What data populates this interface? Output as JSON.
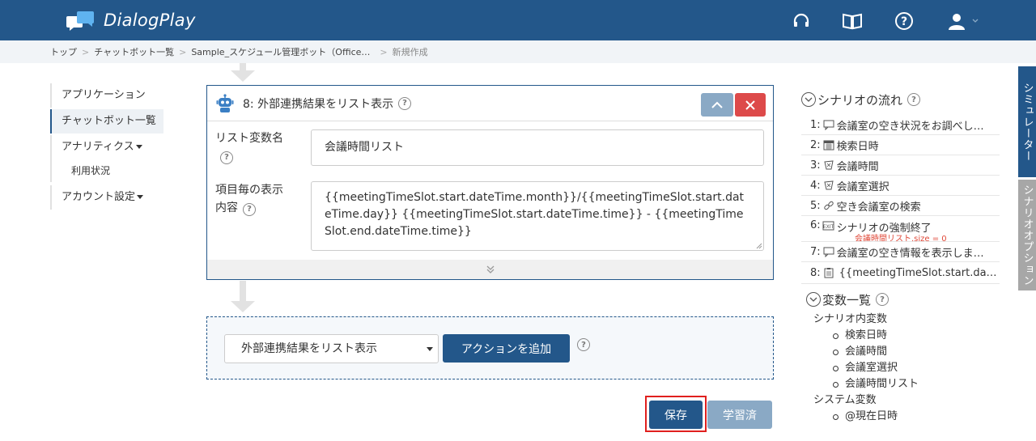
{
  "header": {
    "logo_text": "DialogPlay",
    "icons": [
      "headset-icon",
      "book-icon",
      "help-icon",
      "user-icon"
    ],
    "brand_color": "#23578a"
  },
  "breadcrumb": {
    "items": [
      "トップ",
      "チャットボット一覧",
      "Sample_スケジュール管理ボット（Office…"
    ],
    "current": "新規作成",
    "separator": ">"
  },
  "left_nav": {
    "items": [
      {
        "label": "アプリケーション"
      },
      {
        "label": "チャットボット一覧"
      },
      {
        "label": "アナリティクス"
      },
      {
        "label": "利用状況"
      },
      {
        "label": "アカウント設定"
      }
    ]
  },
  "action_card": {
    "title": "8: 外部連携結果をリスト表示",
    "list_var_label": "リスト変数名",
    "list_var_value": "会議時間リスト",
    "display_label_line1": "項目毎の表示",
    "display_label_line2": "内容",
    "display_value": "{{meetingTimeSlot.start.dateTime.month}}/{{meetingTimeSlot.start.dateTime.day}} {{meetingTimeSlot.start.dateTime.time}} - {{meetingTimeSlot.end.dateTime.time}}"
  },
  "add_action": {
    "select_value": "外部連携結果をリスト表示",
    "add_button": "アクションを追加"
  },
  "footer_buttons": {
    "save": "保存",
    "learned": "学習済"
  },
  "right_panel": {
    "flow_title": "シナリオの流れ",
    "flow_items": [
      {
        "num": "1:",
        "icon": "speech-bubble-icon",
        "label": "会議室の空き状況をお調べし…"
      },
      {
        "num": "2:",
        "icon": "calendar-icon",
        "label": "検索日時"
      },
      {
        "num": "3:",
        "icon": "entity-icon",
        "label": "会議時間"
      },
      {
        "num": "4:",
        "icon": "entity-icon",
        "label": "会議室選択"
      },
      {
        "num": "5:",
        "icon": "link-icon",
        "label": "空き会議室の検索"
      },
      {
        "num": "6:",
        "icon": "exit-icon",
        "label": "シナリオの強制終了",
        "condition": "会議時間リスト.size = 0"
      },
      {
        "num": "7:",
        "icon": "speech-bubble-icon",
        "label": "会議室の空き情報を表示しま…"
      },
      {
        "num": "8:",
        "icon": "list-icon",
        "label": "{{meetingTimeSlot.start.da…"
      }
    ],
    "vars_title": "変数一覧",
    "scenario_vars_label": "シナリオ内変数",
    "scenario_vars": [
      "検索日時",
      "会議時間",
      "会議室選択",
      "会議時間リスト"
    ],
    "system_vars_label": "システム変数",
    "system_vars": [
      "@現在日時"
    ]
  },
  "side_tabs": {
    "simulator": "シミュレーター",
    "scenario_options": "シナリオオプション"
  },
  "help_mark": "?"
}
